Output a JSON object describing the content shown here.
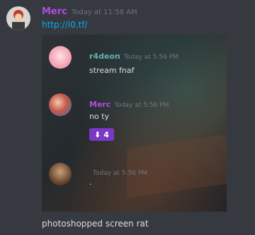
{
  "message": {
    "author": "Merc",
    "timestamp": "Today at 11:58 AM",
    "link": "http://i0.tf/",
    "caption": "photoshopped screen rat"
  },
  "embed": {
    "messages": [
      {
        "author": "r4deon",
        "timestamp": "Today at 5:56 PM",
        "text": "stream fnaf"
      },
      {
        "author": "Merc",
        "timestamp": "Today at 5:56 PM",
        "text": "no ty",
        "reaction": {
          "icon": "down-arrow-icon",
          "symbol": "⬇",
          "count": "4"
        }
      },
      {
        "author": "",
        "timestamp": "Today at 5:56 PM",
        "text": "."
      }
    ]
  },
  "colors": {
    "background": "#36393f",
    "author_merc": "#b14cdc",
    "link": "#00b0f4",
    "reaction": "#7b38c4"
  }
}
